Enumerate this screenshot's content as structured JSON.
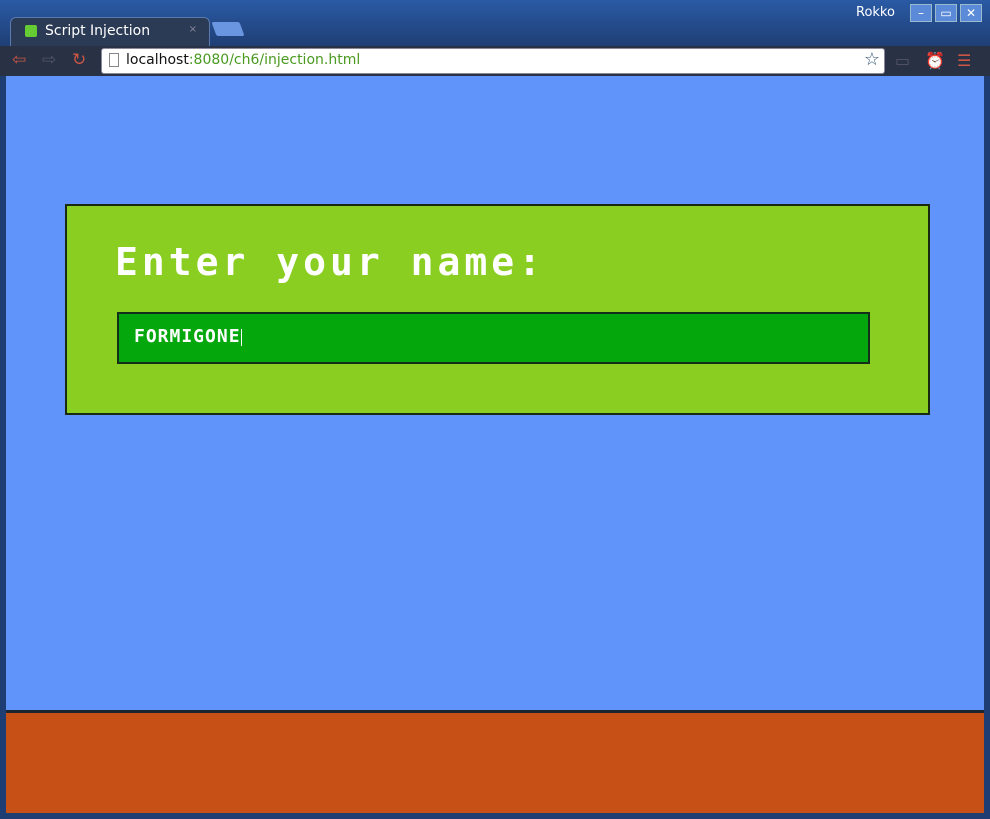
{
  "window": {
    "user": "Rokko",
    "minimize": "–",
    "maximize": "▭",
    "close": "✕"
  },
  "tab": {
    "title": "Script Injection",
    "close": "×"
  },
  "toolbar": {
    "back": "⇦",
    "forward": "⇨",
    "reload": "↻",
    "url_host": "localhost",
    "url_rest": ":8080/ch6/injection.html",
    "star": "☆",
    "ext1": "▭",
    "ext2": "⏰",
    "ext3": "☰"
  },
  "page": {
    "heading": "Enter your name:",
    "name_value": "FORMIGONE"
  },
  "colors": {
    "sky": "#6194fb",
    "panel": "#8ace22",
    "field": "#04a80c",
    "ground": "#c75016"
  }
}
